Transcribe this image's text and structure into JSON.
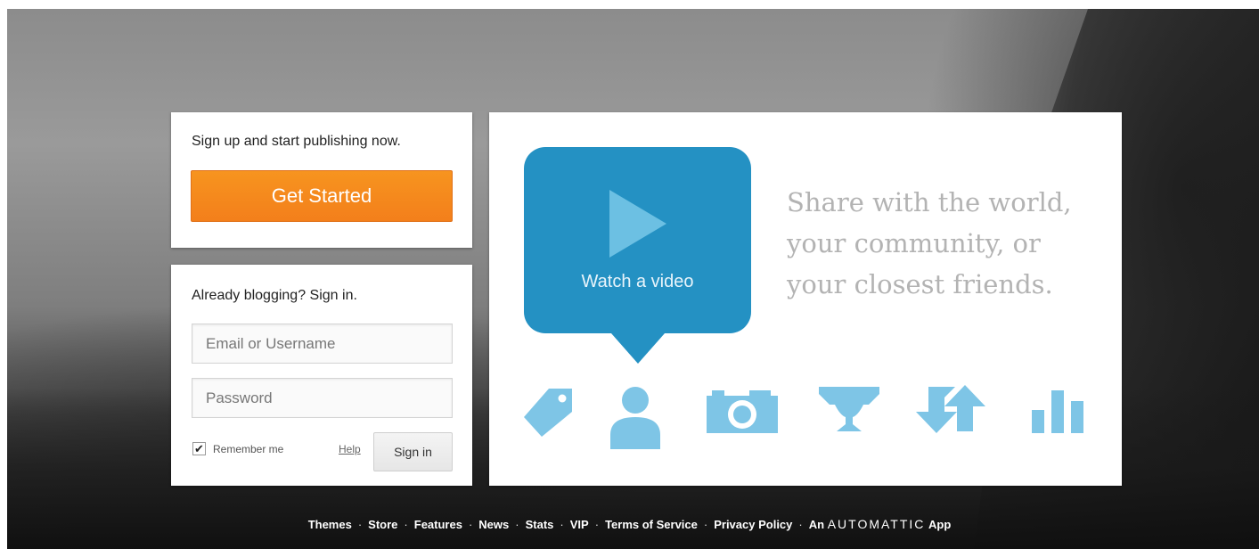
{
  "signup": {
    "title": "Sign up and start publishing now.",
    "cta_label": "Get Started",
    "cta_color": "#f58a1e"
  },
  "signin": {
    "title": "Already blogging? Sign in.",
    "email_placeholder": "Email or Username",
    "password_placeholder": "Password",
    "remember_label": "Remember me",
    "remember_checked": true,
    "help_label": "Help",
    "submit_label": "Sign in"
  },
  "promo": {
    "video_label": "Watch a video",
    "video_color": "#2491c3",
    "tagline": [
      "Share with the world,",
      "your community, or",
      "your closest friends."
    ],
    "feature_icons": [
      "tag-icon",
      "user-icon",
      "camera-icon",
      "trophy-icon",
      "reblog-icon",
      "stats-icon"
    ],
    "icon_color": "#7ec5e6"
  },
  "footer": {
    "links": [
      "Themes",
      "Store",
      "Features",
      "News",
      "Stats",
      "VIP",
      "Terms of Service",
      "Privacy Policy"
    ],
    "separator": "·",
    "app_prefix": "An",
    "brand": "AUTOMATTIC",
    "app_suffix": "App"
  }
}
